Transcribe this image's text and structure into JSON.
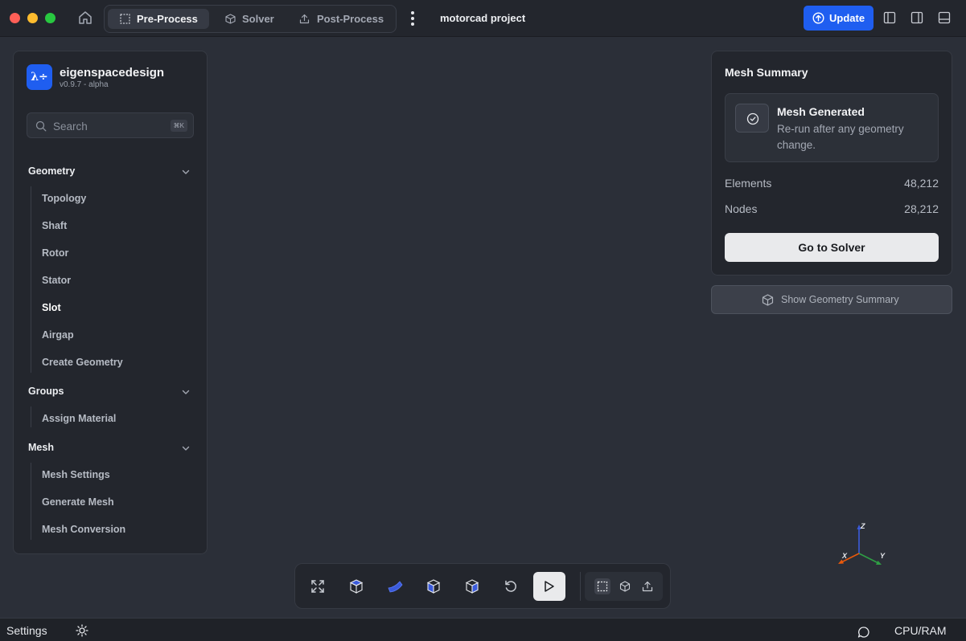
{
  "titlebar": {
    "tabs": [
      {
        "label": "Pre-Process",
        "icon": "selection-square-icon",
        "active": true
      },
      {
        "label": "Solver",
        "icon": "cube-icon",
        "active": false
      },
      {
        "label": "Post-Process",
        "icon": "upload-icon",
        "active": false
      }
    ],
    "project_name": "motorcad project",
    "update_label": "Update"
  },
  "sidebar": {
    "brand_name": "eigenspacedesign",
    "brand_version": "v0.9.7 - alpha",
    "logo_text": "λ÷",
    "search_placeholder": "Search",
    "search_shortcut": "⌘K",
    "groups": [
      {
        "label": "Geometry",
        "items": [
          "Topology",
          "Shaft",
          "Rotor",
          "Stator",
          "Slot",
          "Airgap",
          "Create Geometry"
        ]
      },
      {
        "label": "Groups",
        "items": [
          "Assign Material"
        ]
      },
      {
        "label": "Mesh",
        "items": [
          "Mesh Settings",
          "Generate Mesh",
          "Mesh Conversion"
        ]
      }
    ],
    "active_item": "Slot"
  },
  "summary": {
    "title": "Mesh Summary",
    "status_title": "Mesh Generated",
    "status_desc": "Re-run after any geometry change.",
    "stats": [
      {
        "label": "Elements",
        "value": "48,212"
      },
      {
        "label": "Nodes",
        "value": "28,212"
      }
    ],
    "solver_button": "Go to Solver",
    "geometry_summary_button": "Show Geometry Summary"
  },
  "axes": {
    "x": "X",
    "y": "Y",
    "z": "Z"
  },
  "statusbar": {
    "settings_label": "Settings",
    "cpu_label": "CPU/RAM"
  },
  "colors": {
    "accent": "#1f5ef0",
    "background": "#2b2f38",
    "panel": "#23262d"
  }
}
